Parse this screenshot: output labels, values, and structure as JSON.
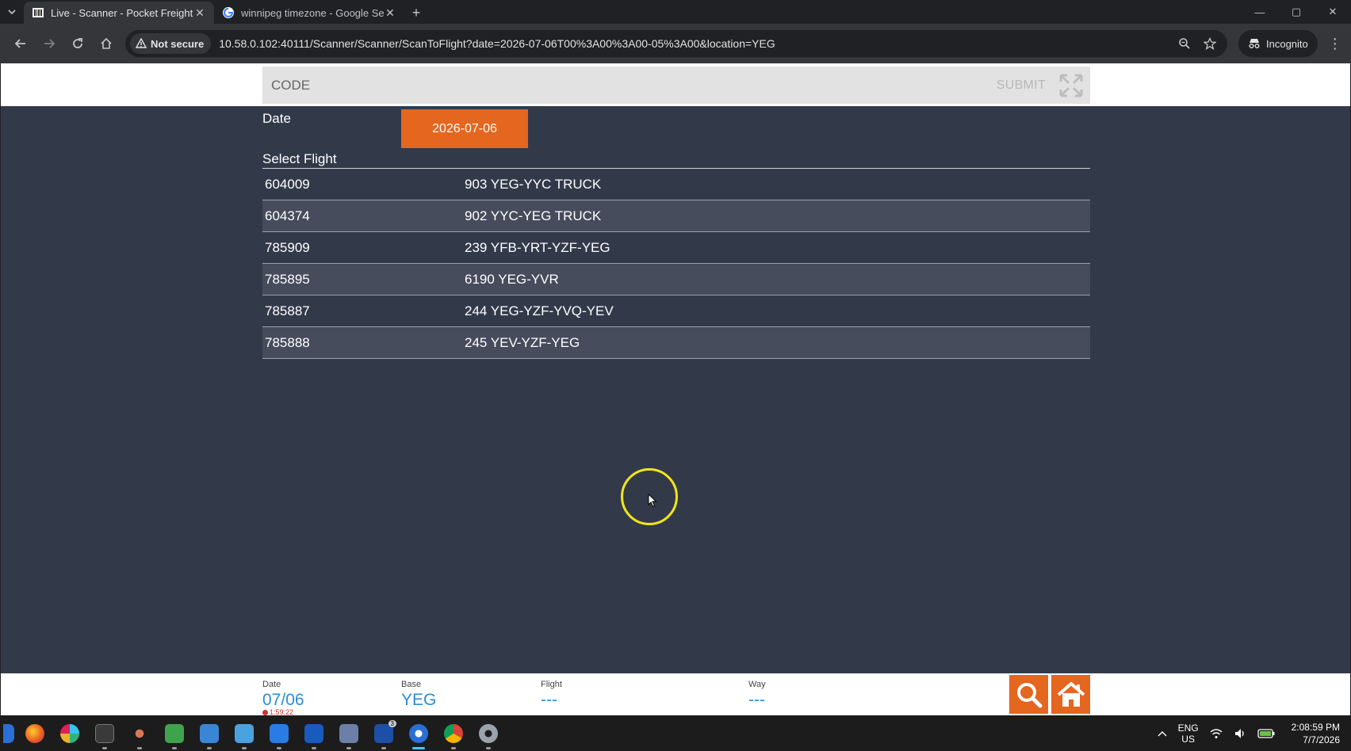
{
  "browser": {
    "tabs": [
      {
        "title": "Live - Scanner - Pocket Freight",
        "active": true
      },
      {
        "title": "winnipeg timezone - Google Se",
        "active": false
      }
    ],
    "security_label": "Not secure",
    "url": "10.58.0.102:40111/Scanner/Scanner/ScanToFlight?date=2026-07-06T00%3A00%3A00-05%3A00&location=YEG",
    "profile_label": "Incognito"
  },
  "scan": {
    "code_placeholder": "CODE",
    "submit_label": "SUBMIT"
  },
  "date_section": {
    "label": "Date",
    "value": "2026-07-06"
  },
  "flights": {
    "label": "Select Flight",
    "rows": [
      {
        "id": "604009",
        "name": "903 YEG-YYC TRUCK"
      },
      {
        "id": "604374",
        "name": "902 YYC-YEG TRUCK"
      },
      {
        "id": "785909",
        "name": "239 YFB-YRT-YZF-YEG"
      },
      {
        "id": "785895",
        "name": "6190 YEG-YVR"
      },
      {
        "id": "785887",
        "name": "244 YEG-YZF-YVQ-YEV"
      },
      {
        "id": "785888",
        "name": "245 YEV-YZF-YEG"
      }
    ]
  },
  "footer": {
    "date_label": "Date",
    "date_value": "07/06",
    "date_time": "1:59:22",
    "base_label": "Base",
    "base_value": "YEG",
    "flight_label": "Flight",
    "flight_value": "---",
    "way_label": "Way",
    "way_value": "---"
  },
  "taskbar": {
    "lang_top": "ENG",
    "lang_bottom": "US",
    "time": "2:08:59 PM",
    "date": "7/7/2026",
    "badge_count": "3"
  },
  "colors": {
    "accent": "#e4661f",
    "page_bg": "#323a4a",
    "value_blue": "#2d8bd6"
  }
}
